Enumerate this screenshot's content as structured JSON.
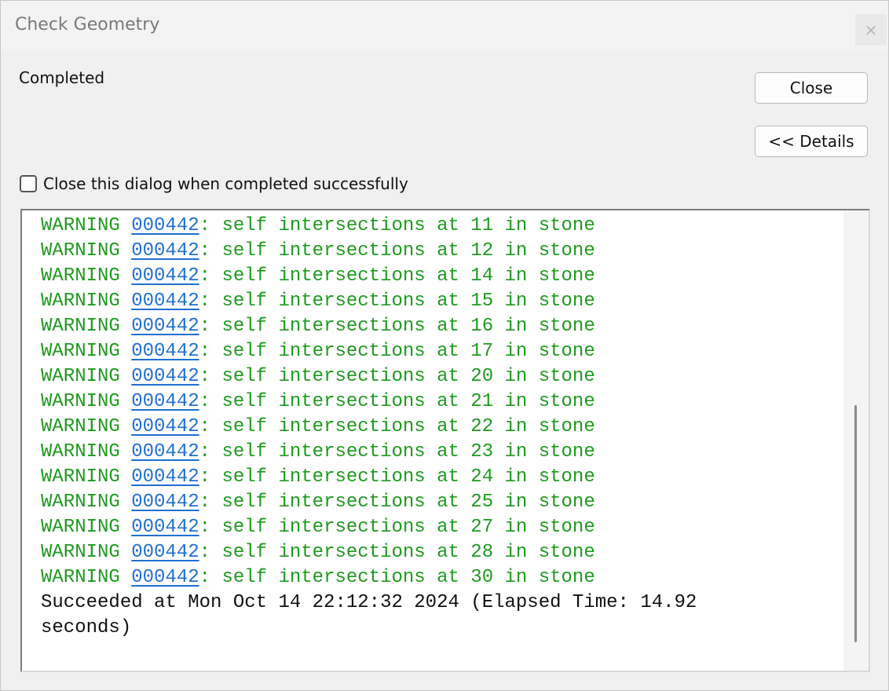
{
  "window": {
    "title": "Check Geometry",
    "close_glyph": "×"
  },
  "status_text": "Completed",
  "buttons": {
    "close_label": "Close",
    "details_label": "<< Details"
  },
  "checkbox": {
    "label": "Close this dialog when completed successfully",
    "checked": false
  },
  "log": {
    "warnings": [
      {
        "prefix": "WARNING ",
        "code": "000442",
        "message": ": self intersections at 11 in stone"
      },
      {
        "prefix": "WARNING ",
        "code": "000442",
        "message": ": self intersections at 12 in stone"
      },
      {
        "prefix": "WARNING ",
        "code": "000442",
        "message": ": self intersections at 14 in stone"
      },
      {
        "prefix": "WARNING ",
        "code": "000442",
        "message": ": self intersections at 15 in stone"
      },
      {
        "prefix": "WARNING ",
        "code": "000442",
        "message": ": self intersections at 16 in stone"
      },
      {
        "prefix": "WARNING ",
        "code": "000442",
        "message": ": self intersections at 17 in stone"
      },
      {
        "prefix": "WARNING ",
        "code": "000442",
        "message": ": self intersections at 20 in stone"
      },
      {
        "prefix": "WARNING ",
        "code": "000442",
        "message": ": self intersections at 21 in stone"
      },
      {
        "prefix": "WARNING ",
        "code": "000442",
        "message": ": self intersections at 22 in stone"
      },
      {
        "prefix": "WARNING ",
        "code": "000442",
        "message": ": self intersections at 23 in stone"
      },
      {
        "prefix": "WARNING ",
        "code": "000442",
        "message": ": self intersections at 24 in stone"
      },
      {
        "prefix": "WARNING ",
        "code": "000442",
        "message": ": self intersections at 25 in stone"
      },
      {
        "prefix": "WARNING ",
        "code": "000442",
        "message": ": self intersections at 27 in stone"
      },
      {
        "prefix": "WARNING ",
        "code": "000442",
        "message": ": self intersections at 28 in stone"
      },
      {
        "prefix": "WARNING ",
        "code": "000442",
        "message": ": self intersections at 30 in stone"
      }
    ],
    "success_message": "Succeeded at Mon Oct 14 22:12:32 2024 (Elapsed Time: 14.92 seconds)"
  },
  "colors": {
    "warning_text": "#1f9a1f",
    "link": "#1f6fd1"
  }
}
